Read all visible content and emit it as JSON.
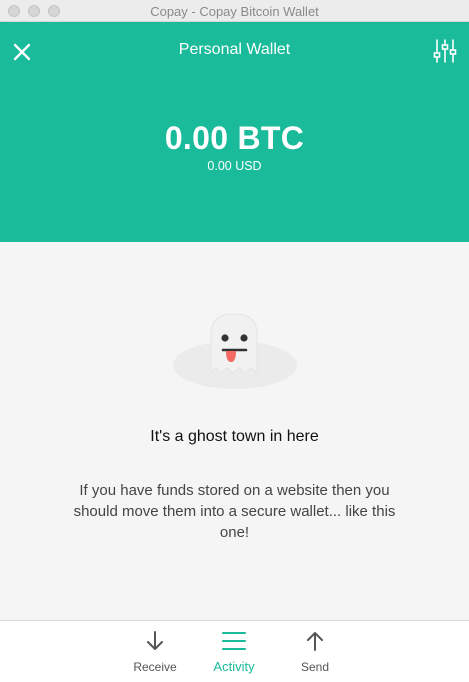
{
  "window": {
    "title": "Copay - Copay Bitcoin Wallet"
  },
  "header": {
    "title": "Personal Wallet",
    "balance": "0.00 BTC",
    "balance_alt": "0.00 USD",
    "close_icon": "close-icon",
    "settings_icon": "sliders-icon"
  },
  "empty_state": {
    "title": "It's a ghost town in here",
    "description": "If you have funds stored on a website then you should move them into a secure wallet... like this one!"
  },
  "tabs": [
    {
      "label": "Receive",
      "icon": "arrow-down-icon",
      "active": false
    },
    {
      "label": "Activity",
      "icon": "menu-lines-icon",
      "active": true
    },
    {
      "label": "Send",
      "icon": "arrow-up-icon",
      "active": false
    }
  ],
  "colors": {
    "accent": "#1abb9b",
    "background": "#f5f5f5",
    "ghost_tongue": "#f26a62"
  }
}
